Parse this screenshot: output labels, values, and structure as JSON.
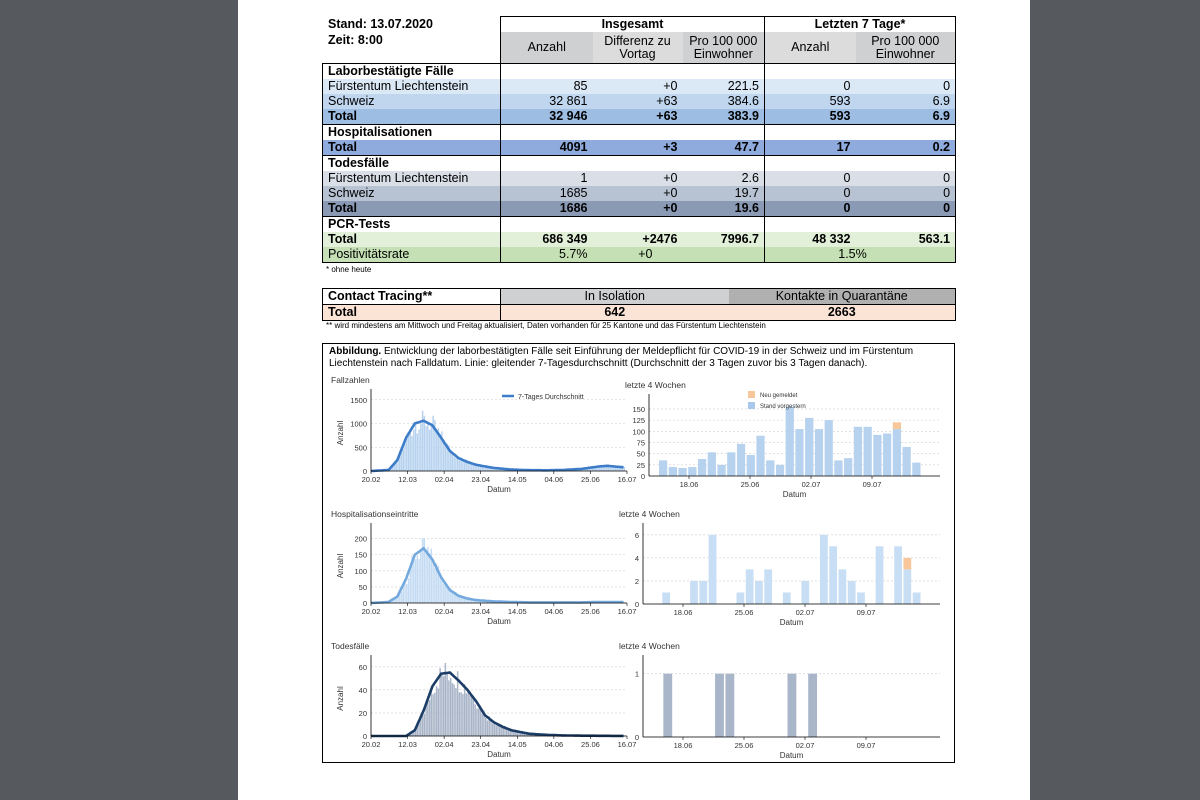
{
  "header": {
    "stand": "Stand: 13.07.2020",
    "zeit": "Zeit: 8:00"
  },
  "groups": {
    "insgesamt": "Insgesamt",
    "letzte7": "Letzten 7 Tage*"
  },
  "columns": {
    "anzahl": "Anzahl",
    "differenz": [
      "Differenz zu",
      "Vortag"
    ],
    "pro100k": [
      "Pro 100 000",
      "Einwohner"
    ],
    "anzahl7": "Anzahl",
    "pro100k7": [
      "Pro 100 000",
      "Einwohner"
    ]
  },
  "sections": {
    "labor": "Laborbestätigte Fälle",
    "hosp": "Hospitalisationen",
    "tod": "Todesfälle",
    "pcr": "PCR-Tests"
  },
  "rows": {
    "labor_fl": [
      "Fürstentum Liechtenstein",
      "85",
      "+0",
      "221.5",
      "0",
      "0"
    ],
    "labor_ch": [
      "Schweiz",
      "32 861",
      "+63",
      "384.6",
      "593",
      "6.9"
    ],
    "labor_total": [
      "Total",
      "32 946",
      "+63",
      "383.9",
      "593",
      "6.9"
    ],
    "hosp_total": [
      "Total",
      "4091",
      "+3",
      "47.7",
      "17",
      "0.2"
    ],
    "tod_fl": [
      "Fürstentum Liechtenstein",
      "1",
      "+0",
      "2.6",
      "0",
      "0"
    ],
    "tod_ch": [
      "Schweiz",
      "1685",
      "+0",
      "19.7",
      "0",
      "0"
    ],
    "tod_total": [
      "Total",
      "1686",
      "+0",
      "19.6",
      "0",
      "0"
    ],
    "pcr_total": [
      "Total",
      "686 349",
      "+2476",
      "7996.7",
      "48 332",
      "563.1"
    ],
    "pcr_pos": [
      "Positivitätsrate",
      "5.7%",
      "+0",
      "1.5%"
    ]
  },
  "note1": "* ohne heute",
  "contact": {
    "title": "Contact Tracing**",
    "isolation": "In Isolation",
    "quarantaene": "Kontakte in Quarantäne",
    "total_label": "Total",
    "isolation_value": "642",
    "quarantaene_value": "2663",
    "note": "** wird mindestens am Mittwoch und Freitag aktualisiert, Daten vorhanden für 25 Kantone und das Fürstentum Liechtenstein"
  },
  "figure": {
    "caption_bold": "Abbildung.",
    "caption_text": " Entwicklung der laborbestätigten Fälle seit Einführung der Meldepflicht für COVID-19 in der Schweiz und im Fürstentum Liechtenstein nach Falldatum. Linie: gleitender 7-Tagesdurchschnitt (Durchschnitt der 3 Tagen zuvor bis 3 Tagen danach).",
    "ylabel": "Anzahl",
    "xlabel": "Datum",
    "colors": {
      "cases": "#3d7cc9",
      "cases_bar": "#b6d2ef",
      "hosp": "#74a9dd",
      "hosp_bar": "#c3dbf3",
      "death": "#1c3d66",
      "death_bar": "#a8b4c7",
      "new": "#f7c69a"
    }
  },
  "chart_data": [
    {
      "type": "bar",
      "title": "Fallzahlen",
      "xlabel": "Datum",
      "ylabel": "Anzahl",
      "x_ticks": [
        "20.02",
        "12.03",
        "02.04",
        "23.04",
        "14.05",
        "04.06",
        "25.06",
        "16.07"
      ],
      "ylim": [
        0,
        1600
      ],
      "y_ticks": [
        0,
        500,
        1000,
        1500
      ],
      "legend": "7-Tages Durchschnitt",
      "series": [
        {
          "name": "7-Tages Durchschnitt",
          "x": [
            0,
            10,
            15,
            20,
            25,
            30,
            35,
            40,
            45,
            50,
            55,
            60,
            70,
            80,
            90,
            100,
            110,
            120,
            130,
            135,
            140,
            144
          ],
          "values": [
            0,
            20,
            230,
            700,
            1000,
            1060,
            960,
            700,
            420,
            270,
            190,
            130,
            65,
            30,
            18,
            15,
            22,
            45,
            95,
            110,
            90,
            80
          ]
        }
      ]
    },
    {
      "type": "bar",
      "title": "letzte 4 Wochen",
      "legend": [
        "Neu gemeldet",
        "Stand vorgestern"
      ],
      "x_ticks": [
        "18.06",
        "25.06",
        "02.07",
        "09.07"
      ],
      "ylim": [
        0,
        170
      ],
      "y_ticks": [
        0,
        25,
        50,
        75,
        100,
        125,
        150
      ],
      "series": [
        {
          "name": "Stand vorgestern",
          "values": [
            35,
            20,
            18,
            20,
            38,
            53,
            25,
            53,
            72,
            47,
            90,
            35,
            25,
            155,
            105,
            130,
            105,
            125,
            35,
            40,
            110,
            110,
            92,
            95,
            105,
            65,
            30
          ]
        },
        {
          "name": "Neu gemeldet",
          "values": [
            0,
            0,
            0,
            0,
            0,
            0,
            0,
            0,
            0,
            0,
            0,
            0,
            0,
            0,
            0,
            0,
            0,
            0,
            0,
            0,
            0,
            0,
            0,
            0,
            15,
            0,
            0
          ]
        }
      ]
    },
    {
      "type": "bar",
      "title": "Hospitalisationseintritte",
      "xlabel": "Datum",
      "ylabel": "Anzahl",
      "x_ticks": [
        "20.02",
        "12.03",
        "02.04",
        "23.04",
        "14.05",
        "04.06",
        "25.06",
        "16.07"
      ],
      "ylim": [
        0,
        230
      ],
      "y_ticks": [
        0,
        50,
        100,
        150,
        200
      ],
      "series": [
        {
          "name": "7-Tages Durchschnitt",
          "x": [
            0,
            10,
            15,
            20,
            25,
            30,
            35,
            40,
            45,
            50,
            55,
            60,
            70,
            80,
            90,
            100,
            110,
            120,
            130,
            140,
            144
          ],
          "values": [
            0,
            3,
            20,
            75,
            150,
            170,
            135,
            80,
            40,
            22,
            14,
            9,
            5,
            3,
            2,
            2,
            2,
            2,
            3,
            3,
            3
          ]
        }
      ]
    },
    {
      "type": "bar",
      "title": "letzte 4 Wochen",
      "x_ticks": [
        "18.06",
        "25.06",
        "02.07",
        "09.07"
      ],
      "ylim": [
        0,
        6.5
      ],
      "y_ticks": [
        0,
        2,
        4,
        6
      ],
      "series": [
        {
          "name": "Stand vorgestern",
          "values": [
            0,
            1,
            0,
            0,
            2,
            2,
            6,
            0,
            0,
            1,
            3,
            2,
            3,
            0,
            1,
            0,
            2,
            0,
            6,
            5,
            3,
            2,
            1,
            0,
            5,
            0,
            5,
            3,
            1
          ]
        },
        {
          "name": "Neu gemeldet",
          "values": [
            0,
            0,
            0,
            0,
            0,
            0,
            0,
            0,
            0,
            0,
            0,
            0,
            0,
            0,
            0,
            0,
            0,
            0,
            0,
            0,
            0,
            0,
            0,
            0,
            0,
            0,
            0,
            1,
            0
          ]
        }
      ]
    },
    {
      "type": "bar",
      "title": "Todesfälle",
      "xlabel": "Datum",
      "ylabel": "Anzahl",
      "x_ticks": [
        "20.02",
        "12.03",
        "02.04",
        "23.04",
        "14.05",
        "04.06",
        "25.06",
        "16.07"
      ],
      "ylim": [
        0,
        65
      ],
      "y_ticks": [
        0,
        20,
        40,
        60
      ],
      "series": [
        {
          "name": "7-Tages Durchschnitt",
          "x": [
            0,
            20,
            25,
            30,
            35,
            40,
            45,
            50,
            55,
            60,
            65,
            70,
            75,
            80,
            90,
            100,
            110,
            120,
            130,
            140,
            144
          ],
          "values": [
            0,
            0,
            5,
            22,
            43,
            54,
            55,
            48,
            40,
            30,
            18,
            12,
            8,
            5,
            2,
            1,
            0.5,
            0.3,
            0.2,
            0.1,
            0.1
          ]
        }
      ]
    },
    {
      "type": "bar",
      "title": "letzte 4 Wochen",
      "x_ticks": [
        "18.06",
        "25.06",
        "02.07",
        "09.07"
      ],
      "ylim": [
        0,
        1.2
      ],
      "y_ticks": [
        0,
        1
      ],
      "series": [
        {
          "name": "Stand vorgestern",
          "values": [
            0,
            1,
            0,
            0,
            0,
            0,
            1,
            1,
            0,
            0,
            0,
            0,
            0,
            1,
            0,
            1,
            0,
            0,
            0,
            0,
            0,
            0,
            0,
            0,
            0,
            0
          ]
        }
      ]
    }
  ]
}
